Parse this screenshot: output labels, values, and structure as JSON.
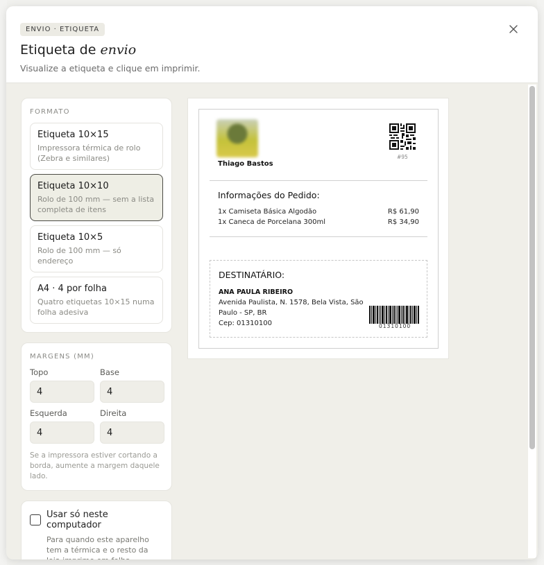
{
  "header": {
    "badge": "ENVIO · ETIQUETA",
    "title_main": "Etiqueta de",
    "title_em": "envio",
    "subtitle": "Visualize a etiqueta e clique em imprimir."
  },
  "format": {
    "section_label": "FORMATO",
    "options": [
      {
        "title": "Etiqueta 10×15",
        "desc": "Impressora térmica de rolo (Zebra e similares)",
        "selected": false
      },
      {
        "title": "Etiqueta 10×10",
        "desc": "Rolo de 100 mm — sem a lista completa de itens",
        "selected": true
      },
      {
        "title": "Etiqueta 10×5",
        "desc": "Rolo de 100 mm — só endereço",
        "selected": false
      },
      {
        "title": "A4 · 4 por folha",
        "desc": "Quatro etiquetas 10×15 numa folha adesiva",
        "selected": false
      }
    ]
  },
  "margins": {
    "section_label": "MARGENS (MM)",
    "top_label": "Topo",
    "top_value": "4",
    "bottom_label": "Base",
    "bottom_value": "4",
    "left_label": "Esquerda",
    "left_value": "4",
    "right_label": "Direita",
    "right_value": "4",
    "hint": "Se a impressora estiver cortando a borda, aumente a margem daquele lado."
  },
  "local_only": {
    "label": "Usar só neste computador",
    "desc": "Para quando este aparelho tem a térmica e o resto da loja imprime em folha.",
    "checked": false
  },
  "label_preview": {
    "sender_name": "Thiago Bastos",
    "order_id": "#95",
    "info_title": "Informações do Pedido:",
    "items": [
      {
        "desc": "1x Camiseta Básica Algodão",
        "price": "R$ 61,90"
      },
      {
        "desc": "1x Caneca de Porcelana 300ml",
        "price": "R$ 34,90"
      }
    ],
    "recipient_title": "DESTINATÁRIO:",
    "recipient_name": "ANA PAULA RIBEIRO",
    "address_line1": "Avenida Paulista, N. 1578, Bela Vista, São",
    "address_line2": "Paulo - SP, BR",
    "cep": "Cep: 01310100",
    "barcode_number": "01310100"
  },
  "icons": {
    "close": "close-icon"
  }
}
